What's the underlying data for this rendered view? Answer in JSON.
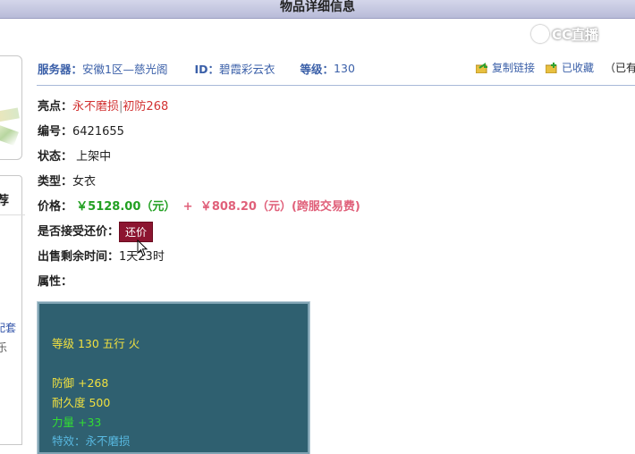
{
  "window": {
    "title": "物品详细信息"
  },
  "brand": {
    "text": "CC直播"
  },
  "sidebar": {
    "recommend_heading": "荐",
    "text1": "配套",
    "text2": "乐"
  },
  "header": {
    "server_label": "服务器：",
    "server_value": "安徽1区—慈光阁",
    "id_label": "ID：",
    "id_value": "碧霞彩云衣",
    "level_label": "等级：",
    "level_value": "130"
  },
  "actions": {
    "copy_link": "复制链接",
    "collected": "已收藏",
    "overflow": "（已有"
  },
  "details": {
    "highlight_label": "亮点：",
    "highlight_1": "永不磨损",
    "highlight_sep": "|",
    "highlight_2": "初防268",
    "number_label": "编号：",
    "number_value": "6421655",
    "status_label": "状态：",
    "status_value": "上架中",
    "type_label": "类型：",
    "type_value": "女衣",
    "price_label": "价格：",
    "price_main": "￥5128.00（元）",
    "price_plus": "+",
    "price_fee": "￥808.20（元）(跨服交易费)",
    "bargain_label": "是否接受还价：",
    "bargain_button": "还价",
    "remaining_label": "出售剩余时间：",
    "remaining_value": "1天23时",
    "attr_label": "属性："
  },
  "attributes": {
    "level_line": "等级 130 五行 火",
    "defense": "防御 +268",
    "durability": "耐久度 500",
    "strength": "力量 +33",
    "effect": "特效：永不磨损"
  },
  "colors": {
    "accent": "#3a5fa8",
    "price_green": "#22a022",
    "fee_pink": "#e0607a",
    "button": "#8c1530",
    "attr_bg": "#2f6070"
  }
}
